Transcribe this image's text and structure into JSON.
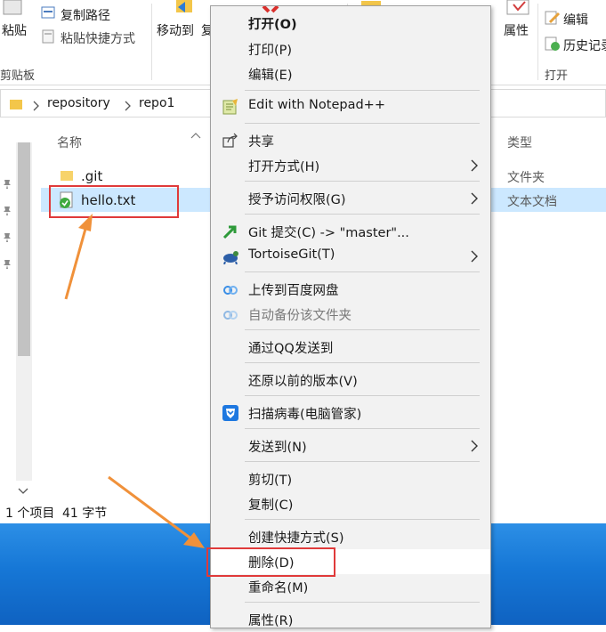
{
  "ribbon": {
    "paste_label": "粘贴",
    "copy_path_label": "复制路径",
    "paste_shortcut_label": "粘贴快捷方式",
    "clipboard_group": "剪贴板",
    "move_to_label": "移动到",
    "copy_to_partial": "复",
    "properties_label": "属性",
    "edit_label": "编辑",
    "history_label": "历史记录",
    "open_group": "打开"
  },
  "address": {
    "crumbs": [
      "repository",
      "repo1"
    ]
  },
  "file_list": {
    "column_name": "名称",
    "column_type": "类型",
    "rows": [
      {
        "name": ".git",
        "type": "文件夹",
        "selected": false
      },
      {
        "name": "hello.txt",
        "type": "文本文档",
        "selected": true
      }
    ]
  },
  "status": {
    "count": "1 个项目",
    "size": "41 字节"
  },
  "context_menu": {
    "items": [
      {
        "label": "打开(O)",
        "bold": true
      },
      {
        "label": "打印(P)"
      },
      {
        "label": "编辑(E)"
      },
      {
        "label": "Edit with Notepad++",
        "icon": "notepad-plus-plus-icon"
      },
      {
        "label": "共享",
        "icon": "share-icon"
      },
      {
        "label": "打开方式(H)",
        "submenu": true
      },
      {
        "label": "授予访问权限(G)",
        "submenu": true
      },
      {
        "label": "Git 提交(C) -> \"master\"...",
        "icon": "git-commit-icon"
      },
      {
        "label": "TortoiseGit(T)",
        "icon": "tortoisegit-icon",
        "submenu": true
      },
      {
        "label": "上传到百度网盘",
        "icon": "baidu-netdisk-icon"
      },
      {
        "label": "自动备份该文件夹",
        "icon": "baidu-netdisk-icon",
        "disabled": true
      },
      {
        "label": "通过QQ发送到"
      },
      {
        "label": "还原以前的版本(V)"
      },
      {
        "label": "扫描病毒(电脑管家)",
        "icon": "tencent-pc-manager-icon"
      },
      {
        "label": "发送到(N)",
        "submenu": true
      },
      {
        "label": "剪切(T)"
      },
      {
        "label": "复制(C)"
      },
      {
        "label": "创建快捷方式(S)"
      },
      {
        "label": "删除(D)",
        "highlighted": true
      },
      {
        "label": "重命名(M)"
      },
      {
        "label": "属性(R)"
      }
    ]
  },
  "colors": {
    "selection": "#cce8ff",
    "annotation_red": "#e03a3a",
    "annotation_orange": "#f0913a",
    "desktop_blue": "#1677d6",
    "menu_bg": "#f2f2f2"
  }
}
